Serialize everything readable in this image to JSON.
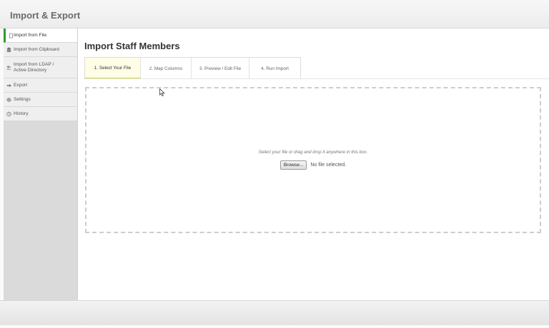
{
  "app": {
    "title": "Import & Export"
  },
  "sidebar": {
    "items": [
      {
        "label": "Import from File",
        "icon": "file-icon",
        "active": true
      },
      {
        "label": "Import from Clipboard",
        "icon": "clipboard-icon"
      },
      {
        "label": "Import from LDAP / Active Directory",
        "label_line1": "Import from LDAP /",
        "label_line2": "Active Directory",
        "icon": "users-icon"
      },
      {
        "label": "Export",
        "icon": "arrow-right-icon"
      },
      {
        "label": "Settings",
        "icon": "gear-icon"
      },
      {
        "label": "History",
        "icon": "clock-icon"
      }
    ]
  },
  "main": {
    "title": "Import Staff Members",
    "tabs": [
      {
        "label": "1. Select Your File",
        "active": true
      },
      {
        "label": "2. Map Columns"
      },
      {
        "label": "3. Preview / Edit File"
      },
      {
        "label": "4. Run Import"
      }
    ],
    "dropzone": {
      "hint": "Select your file or drag and drop it anywhere in this box.",
      "browse_label": "Browse...",
      "file_status": "No file selected."
    }
  },
  "colors": {
    "active_accent": "#2e9c2e",
    "active_tab_bg": "#fffde6",
    "active_tab_underline": "#c8d84a"
  }
}
